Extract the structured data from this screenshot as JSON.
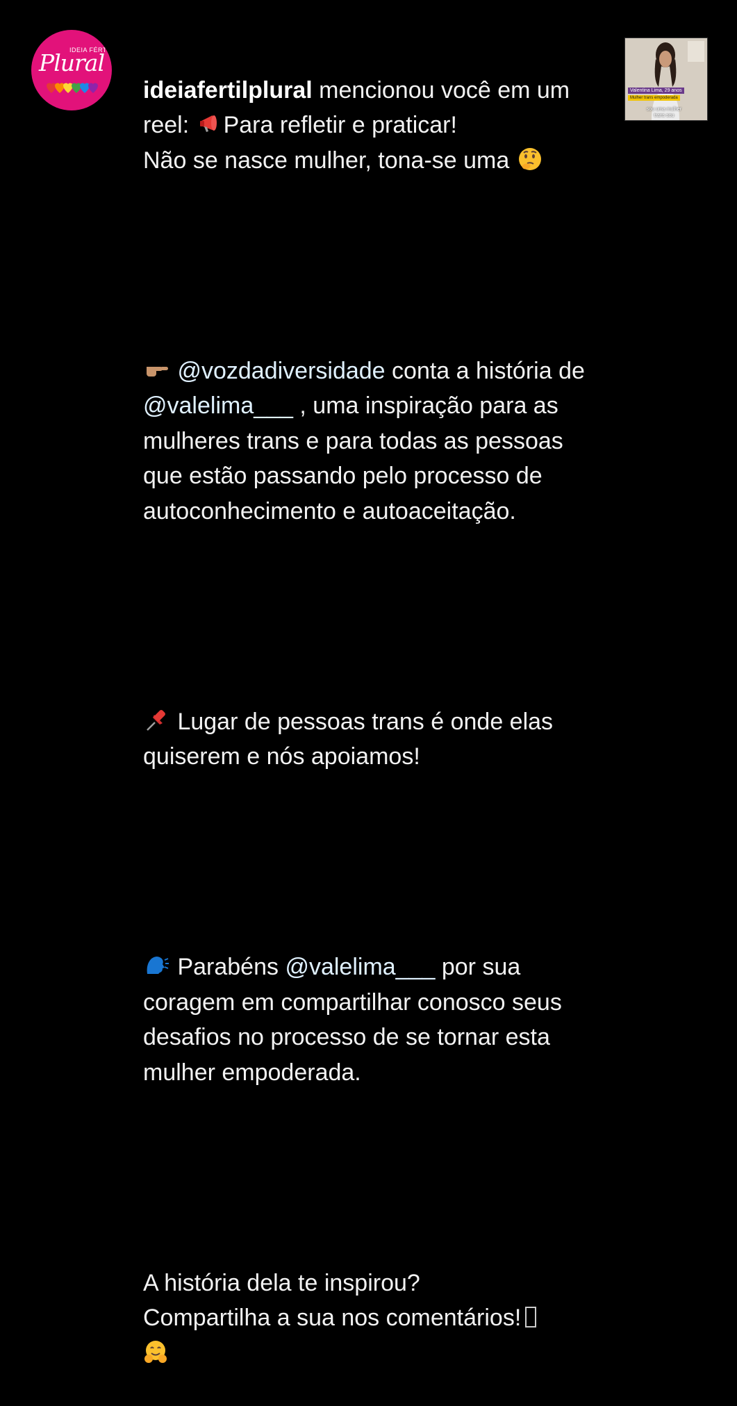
{
  "notification": {
    "avatar": {
      "label_small": "IDEIA FÉRTIL",
      "label_script": "Plural",
      "background": "#e2127a"
    },
    "username": "ideiafertilplural",
    "action_text": " mencionou você em um reel: ",
    "lines": {
      "intro_a": "Para refletir e praticar!",
      "intro_b": "Não se nasce mulher, tona-se uma ",
      "p2_pre": " ",
      "p2_mention1": "@vozdadiversidade",
      "p2_mid": " conta a história de ",
      "p2_mention2": "@valelima___",
      "p2_post": " , uma inspiração para as mulheres trans e para todas as pessoas que estão passando pelo processo de autoconhecimento e autoaceitação.",
      "p3": " Lugar de pessoas trans é onde elas quiserem e nós apoiamos!",
      "p4_pre": " Parabéns ",
      "p4_mention": "@valelima___",
      "p4_post": " por sua coragem em compartilhar conosco seus desafios no processo de se tornar esta mulher empoderada.",
      "p5_a": "A história dela te inspirou?",
      "p5_b": "Compartilha a sua nos comentários!"
    },
    "emoji_names": [
      "megaphone-emoji",
      "thinking-face-emoji",
      "pointing-right-emoji",
      "pushpin-emoji",
      "speaking-head-emoji",
      "hugging-face-emoji"
    ],
    "thumbnail": {
      "caption_name": "Valentina Lima, 29 anos",
      "caption_role": "Mulher trans empoderada",
      "caption_sub": "sou uma mulher trans sou"
    }
  }
}
